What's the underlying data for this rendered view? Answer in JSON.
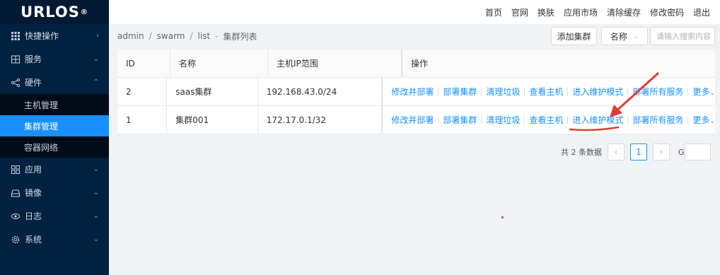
{
  "logo": {
    "text": "URLOS",
    "mark": "®"
  },
  "sidebar": {
    "items": [
      {
        "icon": "grid-icon",
        "label": "快捷操作",
        "arrow": "›"
      },
      {
        "icon": "server-icon",
        "label": "服务",
        "arrow": "⌄"
      },
      {
        "icon": "share-icon",
        "label": "硬件",
        "arrow": "⌃"
      },
      {
        "icon": "apps-icon",
        "label": "应用",
        "arrow": "⌄"
      },
      {
        "icon": "drive-icon",
        "label": "镜像",
        "arrow": "⌄"
      },
      {
        "icon": "eye-icon",
        "label": "日志",
        "arrow": "⌄"
      },
      {
        "icon": "settings-icon",
        "label": "系统",
        "arrow": "⌄"
      }
    ],
    "sub_items": [
      "主机管理",
      "集群管理",
      "容器网络"
    ]
  },
  "topbar": {
    "links": [
      "首页",
      "官网",
      "换肤",
      "应用市场",
      "清除缓存",
      "修改密码",
      "退出"
    ]
  },
  "breadcrumb": {
    "parts": [
      "admin",
      "swarm",
      "list"
    ],
    "dash": "-",
    "title": "集群列表"
  },
  "toolbar": {
    "add_label": "添加集群",
    "name_select": "名称",
    "search_placeholder": "请输入搜索内容"
  },
  "table": {
    "headers": [
      "ID",
      "名称",
      "主机IP范围",
      "操作"
    ],
    "rows": [
      {
        "id": "2",
        "name": "saas集群",
        "ip": "192.168.43.0/24"
      },
      {
        "id": "1",
        "name": "集群001",
        "ip": "172.17.0.1/32"
      }
    ],
    "actions": [
      "修改并部署",
      "部署集群",
      "清理垃圾",
      "查看主机",
      "进入维护模式",
      "部署所有服务",
      "更多"
    ]
  },
  "pagination": {
    "total": "共 2 条数据",
    "current": "1",
    "goto": "Goto"
  },
  "colors": {
    "sidebar": "#002140",
    "active": "#1890ff",
    "annotation": "#e53935"
  }
}
